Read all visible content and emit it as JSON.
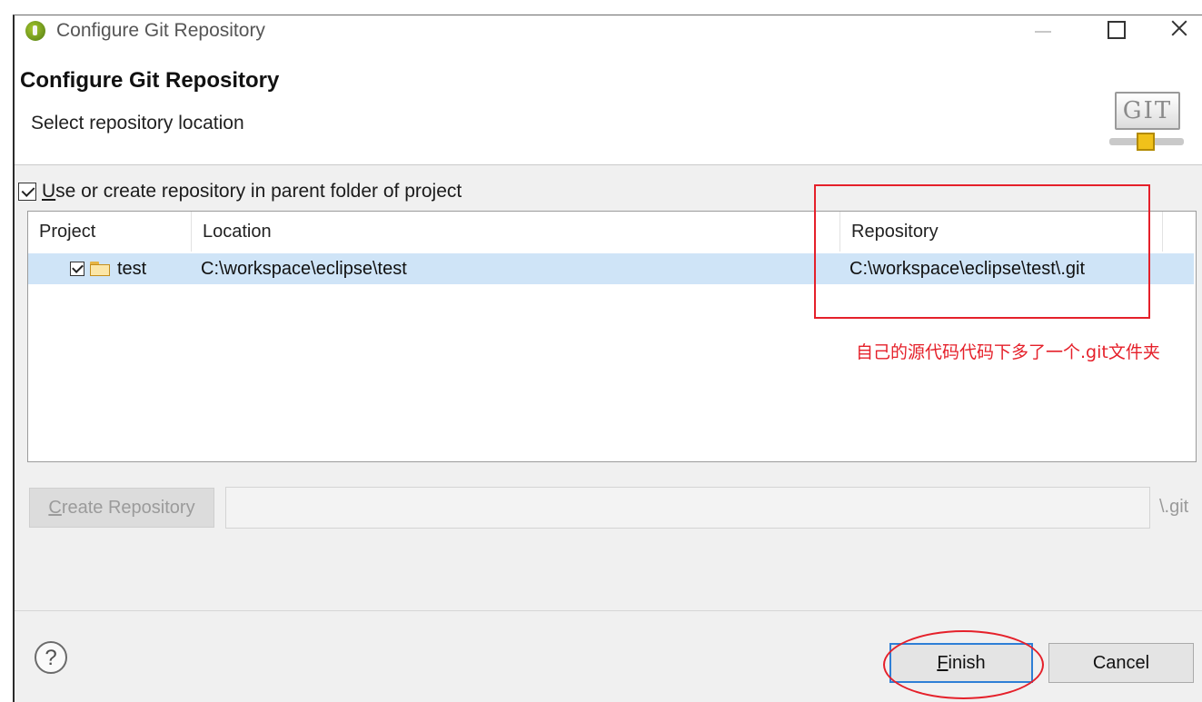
{
  "window": {
    "title": "Configure Git Repository"
  },
  "header": {
    "title": "Configure Git Repository",
    "subtitle": "Select repository location",
    "logo_text": "GIT"
  },
  "options": {
    "parent_folder_label": "Use or create repository in parent folder of project",
    "parent_folder_mnemonic": "U",
    "parent_folder_rest": "se or create repository in parent folder of project",
    "parent_folder_checked": true
  },
  "table": {
    "columns": [
      "Project",
      "Location",
      "Repository"
    ],
    "rows": [
      {
        "project": "test",
        "location": "C:\\workspace\\eclipse\\test",
        "repository": "C:\\workspace\\eclipse\\test\\.git",
        "checked": true,
        "selected": true
      }
    ]
  },
  "create": {
    "button_label": "Create Repository",
    "button_mnemonic": "C",
    "button_rest": "reate Repository",
    "path_value": "",
    "suffix": "\\.git"
  },
  "footer": {
    "help_label": "?",
    "finish_label": "Finish",
    "finish_mnemonic": "F",
    "finish_rest": "inish",
    "cancel_label": "Cancel"
  },
  "annotation": {
    "note": "自己的源代码代码下多了一个.git文件夹",
    "color": "#e5202a"
  },
  "colors": {
    "selection": "#cfe4f7",
    "default_button_border": "#2e7fd6",
    "dialog_background": "#f0f0f0"
  }
}
